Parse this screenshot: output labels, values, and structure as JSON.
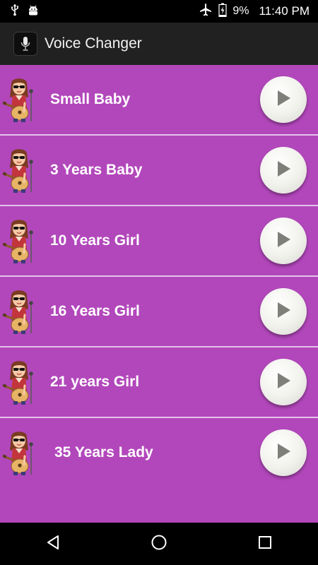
{
  "status_bar": {
    "battery_percent": "9%",
    "time": "11:40 PM",
    "icons": [
      "usb-icon",
      "android-debug-icon",
      "airplane-icon",
      "battery-charging-icon"
    ]
  },
  "app_bar": {
    "title": "Voice Changer",
    "icon": "microphone-icon"
  },
  "voices": [
    {
      "label": "Small Baby"
    },
    {
      "label": "3 Years Baby"
    },
    {
      "label": "10 Years Girl"
    },
    {
      "label": "16 Years Girl"
    },
    {
      "label": "21 years Girl"
    },
    {
      "label": "35 Years Lady"
    }
  ],
  "nav_bar": {
    "icons": [
      "back-icon",
      "home-icon",
      "recents-icon"
    ]
  },
  "colors": {
    "list_background": "#b247bb",
    "divider": "#e6c2ea",
    "app_bar": "#212121",
    "status_bar": "#000000"
  }
}
